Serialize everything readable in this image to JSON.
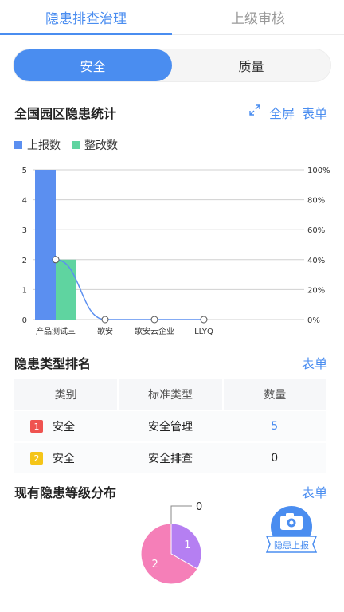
{
  "tabs": [
    "隐患排查治理",
    "上级审核"
  ],
  "segments": [
    "安全",
    "质量"
  ],
  "stats": {
    "title": "全国园区隐患统计",
    "fullscreen_label": "全屏",
    "table_label": "表单"
  },
  "legend": {
    "reported": "上报数",
    "rectified": "整改数"
  },
  "colors": {
    "accent": "#4a8df0",
    "bar_reported": "#5b8ff0",
    "bar_rectified": "#5fd4a0",
    "badge_1": "#ef5350",
    "badge_2": "#f5c518",
    "pie_1": "#b57ff2",
    "pie_2": "#f57fb8"
  },
  "chart_data": {
    "type": "bar",
    "categories": [
      "产品测试三",
      "歌安",
      "歌安云企业",
      "LLYQ"
    ],
    "series": [
      {
        "name": "上报数",
        "type": "bar",
        "values": [
          5,
          0,
          0,
          0
        ]
      },
      {
        "name": "整改数",
        "type": "bar",
        "values": [
          2,
          0,
          0,
          0
        ]
      },
      {
        "type": "line",
        "axis": "right",
        "values": [
          40,
          0,
          0,
          0
        ]
      }
    ],
    "y_left": {
      "min": 0,
      "max": 5,
      "ticks": [
        "0",
        "1",
        "2",
        "3",
        "4",
        "5"
      ]
    },
    "y_right": {
      "min": 0,
      "max": 100,
      "ticks": [
        "0%",
        "20%",
        "40%",
        "60%",
        "80%",
        "100%"
      ]
    },
    "grid": true,
    "legend_position": "top-left"
  },
  "ranking": {
    "title": "隐患类型排名",
    "table_label": "表单",
    "headers": [
      "类别",
      "标准类型",
      "数量"
    ],
    "rows": [
      {
        "rank": "1",
        "category": "安全",
        "type": "安全管理",
        "count": "5"
      },
      {
        "rank": "2",
        "category": "安全",
        "type": "安全排查",
        "count": "0"
      }
    ]
  },
  "distribution": {
    "title": "现有隐患等级分布",
    "table_label": "表单",
    "pie": [
      {
        "label": "1",
        "value": 1
      },
      {
        "label": "2",
        "value": 2
      },
      {
        "label": "0",
        "value": 0
      }
    ]
  },
  "report_button": {
    "label": "隐患上报",
    "icon": "camera-icon"
  }
}
